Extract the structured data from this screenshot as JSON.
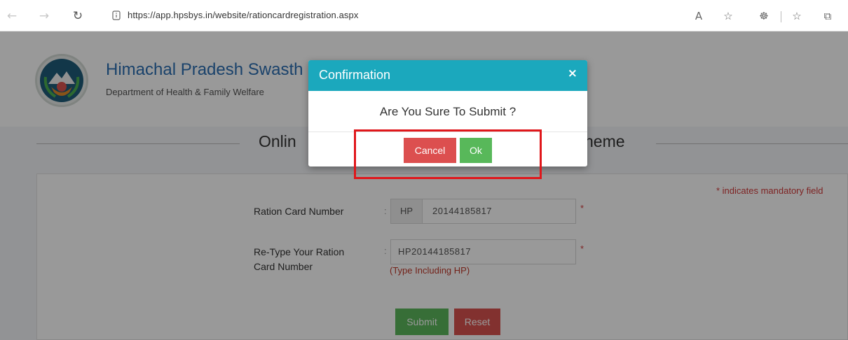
{
  "browser": {
    "url": "https://app.hpsbys.in/website/rationcardregistration.aspx",
    "back_icon": "back-arrow-icon",
    "forward_icon": "forward-arrow-icon",
    "refresh_icon": "refresh-icon",
    "lock_icon": "site-info-icon",
    "toolbar_icons": [
      "read-aloud-icon",
      "add-favorite-icon",
      "extensions-icon",
      "favorites-icon",
      "collections-icon"
    ]
  },
  "header": {
    "title": "Himachal Pradesh Swasth",
    "subtitle": "Department of Health & Family Welfare"
  },
  "section": {
    "title_left": "Onlin",
    "title_right": "heme"
  },
  "form": {
    "mandatory_note": "* indicates mandatory field",
    "ration_card_label": "Ration Card Number",
    "colon": ":",
    "ration_prefix": "HP",
    "ration_value": "20144185817",
    "retype_label_line1": "Re-Type Your Ration",
    "retype_label_line2": "Card Number",
    "retype_value": "HP20144185817",
    "retype_hint": "(Type Including HP)",
    "required_mark": "*",
    "submit_label": "Submit",
    "reset_label": "Reset"
  },
  "modal": {
    "title": "Confirmation",
    "close_symbol": "×",
    "message": "Are You Sure To Submit ?",
    "cancel_label": "Cancel",
    "ok_label": "Ok"
  },
  "colors": {
    "modal_header": "#1ba8bd",
    "cancel": "#dc4f4f",
    "ok": "#58b85a",
    "highlight": "#e0171b",
    "title_blue": "#2c6fb3"
  }
}
